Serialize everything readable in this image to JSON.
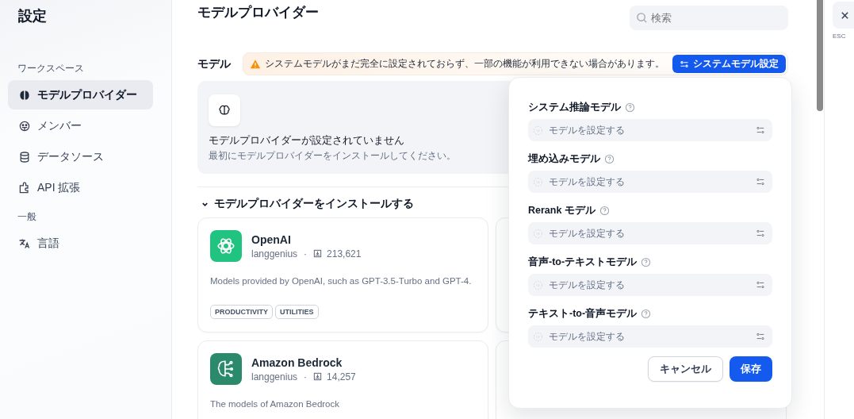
{
  "sidebar": {
    "title": "設定",
    "groups": [
      {
        "label": "ワークスペース",
        "items": [
          {
            "label": "モデルプロバイダー",
            "selected": true
          },
          {
            "label": "メンバー",
            "selected": false
          },
          {
            "label": "データソース",
            "selected": false
          },
          {
            "label": "API 拡張",
            "selected": false
          }
        ]
      },
      {
        "label": "一般",
        "items": [
          {
            "label": "言語",
            "selected": false
          }
        ]
      }
    ]
  },
  "header": {
    "title": "モデルプロバイダー",
    "search": {
      "placeholder": "検索"
    }
  },
  "close": {
    "hint": "ESC"
  },
  "models": {
    "label": "モデル",
    "warning": "システムモデルがまだ完全に設定されておらず、一部の機能が利用できない場合があります。",
    "button": "システムモデル設定",
    "empty": {
      "title": "モデルプロバイダーが設定されていません",
      "subtitle": "最初にモデルプロバイダーをインストールしてください。"
    }
  },
  "install": {
    "heading": "モデルプロバイダーをインストールする",
    "expanded": true,
    "providers": [
      {
        "name": "OpenAI",
        "author": "langgenius",
        "separator": "·",
        "installs": "213,621",
        "description": "Models provided by OpenAI, such as GPT-3.5-Turbo and GPT-4.",
        "tags": [
          "PRODUCTIVITY",
          "UTILITIES"
        ]
      },
      {
        "name": "Amazon Bedrock",
        "author": "langgenius",
        "separator": "·",
        "installs": "14,257",
        "description": "The models of Amazon Bedrock"
      }
    ]
  },
  "system_model_popup": {
    "fields": [
      {
        "label": "システム推論モデル",
        "placeholder": "モデルを設定する"
      },
      {
        "label": "埋め込みモデル",
        "placeholder": "モデルを設定する"
      },
      {
        "label": "Rerank モデル",
        "placeholder": "モデルを設定する"
      },
      {
        "label": "音声-to-テキストモデル",
        "placeholder": "モデルを設定する"
      },
      {
        "label": "テキスト-to-音声モデル",
        "placeholder": "モデルを設定する"
      }
    ],
    "cancel": "キャンセル",
    "save": "保存"
  }
}
